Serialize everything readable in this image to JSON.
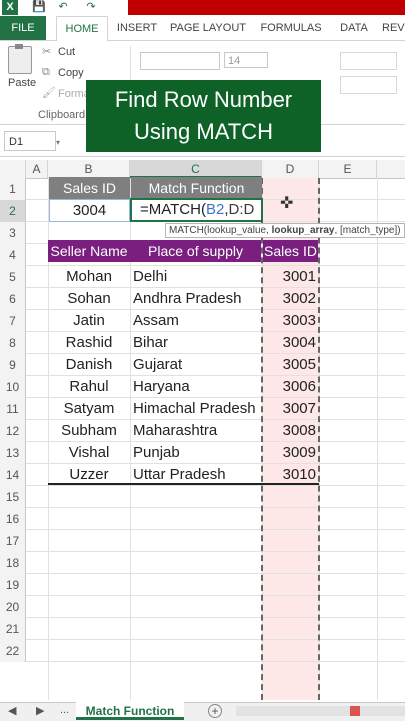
{
  "quick_access": {
    "logo": "X",
    "save_icon": "💾",
    "undo_icon": "↶",
    "redo_icon": "↷"
  },
  "tabs": [
    "FILE",
    "HOME",
    "INSERT",
    "PAGE LAYOUT",
    "FORMULAS",
    "DATA",
    "REV"
  ],
  "ribbon": {
    "paste": "Paste",
    "cut": "Cut",
    "copy": "Copy",
    "format_painter": "Forma",
    "clipboard": "Clipboard",
    "font_size": "14"
  },
  "banner": {
    "line1": "Find Row Number",
    "line2": "Using MATCH"
  },
  "name_box": "D1",
  "columns": [
    "A",
    "B",
    "C",
    "D",
    "E"
  ],
  "rows": [
    "1",
    "2",
    "3",
    "4",
    "5",
    "6",
    "7",
    "8",
    "9",
    "10",
    "11",
    "12",
    "13",
    "14",
    "15",
    "16",
    "17",
    "18",
    "19",
    "20",
    "21",
    "22"
  ],
  "cells": {
    "b1": "Sales ID",
    "c1": "Match Function",
    "b2": "3004",
    "c2_prefix": "=MATCH(",
    "c2_ref1": "B2",
    "c2_sep": ",",
    "c2_ref2": "D:D",
    "tooltip_pre": "MATCH(lookup_value, ",
    "tooltip_bold": "lookup_array",
    "tooltip_post": ", [match_type])"
  },
  "table": {
    "headers": [
      "Seller Name",
      "Place of supply",
      "Sales ID"
    ],
    "rows": [
      [
        "Mohan",
        "Delhi",
        "3001"
      ],
      [
        "Sohan",
        "Andhra Pradesh",
        "3002"
      ],
      [
        "Jatin",
        "Assam",
        "3003"
      ],
      [
        "Rashid",
        "Bihar",
        "3004"
      ],
      [
        "Danish",
        "Gujarat",
        "3005"
      ],
      [
        "Rahul",
        "Haryana",
        "3006"
      ],
      [
        "Satyam",
        "Himachal Pradesh",
        "3007"
      ],
      [
        "Subham",
        "Maharashtra",
        "3008"
      ],
      [
        "Vishal",
        "Punjab",
        "3009"
      ],
      [
        "Uzzer",
        "Uttar Pradesh",
        "3010"
      ]
    ]
  },
  "sheet_tabs": {
    "active": "Match Function",
    "ellipsis": "...",
    "add": "+"
  },
  "colors": {
    "excel_green": "#217346",
    "banner_green": "#0e6227",
    "header_purple": "#7a1f80",
    "header_gray": "#7f7f7f",
    "column_highlight": "#fde7e7"
  }
}
